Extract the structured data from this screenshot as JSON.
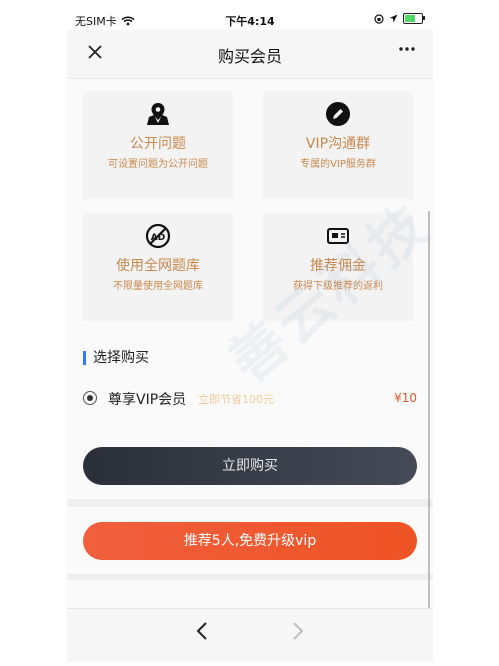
{
  "status_bar": {
    "carrier": "无SIM卡",
    "time": "下午4:14"
  },
  "nav": {
    "title": "购买会员"
  },
  "features": [
    {
      "icon": "map-pin-icon",
      "title": "公开问题",
      "subtitle": "可设置问题为公开问题"
    },
    {
      "icon": "pencil-icon",
      "title": "VIP沟通群",
      "subtitle": "专属的VIP服务群"
    },
    {
      "icon": "no-ads-icon",
      "title": "使用全网题库",
      "subtitle": "不限量使用全网题库"
    },
    {
      "icon": "card-icon",
      "title": "推荐佣金",
      "subtitle": "获得下级推荐的返利"
    }
  ],
  "purchase": {
    "section_title": "选择购买",
    "option_name": "尊享VIP会员",
    "option_note": "立即节省100元",
    "price": "¥10",
    "buy_button": "立即购买",
    "recommend_button": "推荐5人,免费升级vip"
  },
  "watermark": "善云科技"
}
